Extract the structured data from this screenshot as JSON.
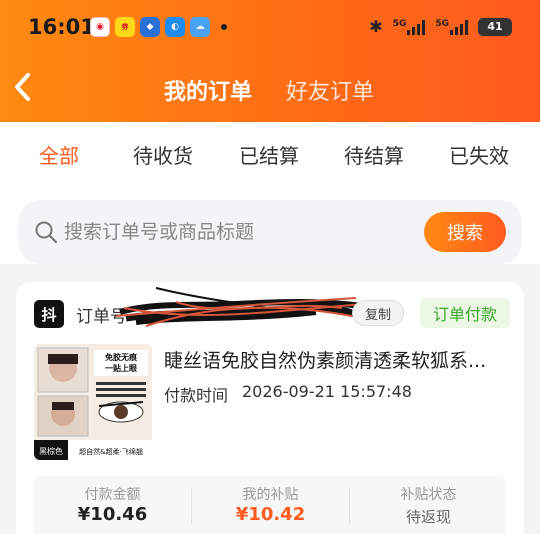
{
  "status_bar": {
    "time": "16:01",
    "signal1_label": "5G",
    "signal2_label": "5G",
    "battery": "41"
  },
  "header": {
    "back_icon": "chevron-left-icon",
    "tab_mine": "我的订单",
    "tab_friend": "好友订单"
  },
  "filter_tabs": [
    "全部",
    "待收货",
    "已结算",
    "待结算",
    "已失效"
  ],
  "search": {
    "placeholder": "搜索订单号或商品标题",
    "button_label": "搜索"
  },
  "order": {
    "shop_logo": "抖",
    "order_no_label": "订单号",
    "copy_label": "复制",
    "status": "订单付款",
    "product_title": "睫丝语免胶自然伪素颜清透柔软狐系...",
    "pay_time_label": "付款时间",
    "pay_time": "2026-09-21 15:57:48",
    "image_text": {
      "badge": "免胶无痕 一贴上眼",
      "bottom_left": "黑棕色",
      "bottom_right": "超自然&超柔·飞绵翘"
    },
    "summary": {
      "amount_label": "付款金额",
      "amount_value": "¥10.46",
      "subsidy_label": "我的补贴",
      "subsidy_value": "¥10.42",
      "subsidy_status_label": "补贴状态",
      "subsidy_status_value": "待返现"
    }
  },
  "colors": {
    "accent": "#ff5a1f",
    "header_start": "#ff8a12",
    "status_green": "#3aa62e"
  }
}
